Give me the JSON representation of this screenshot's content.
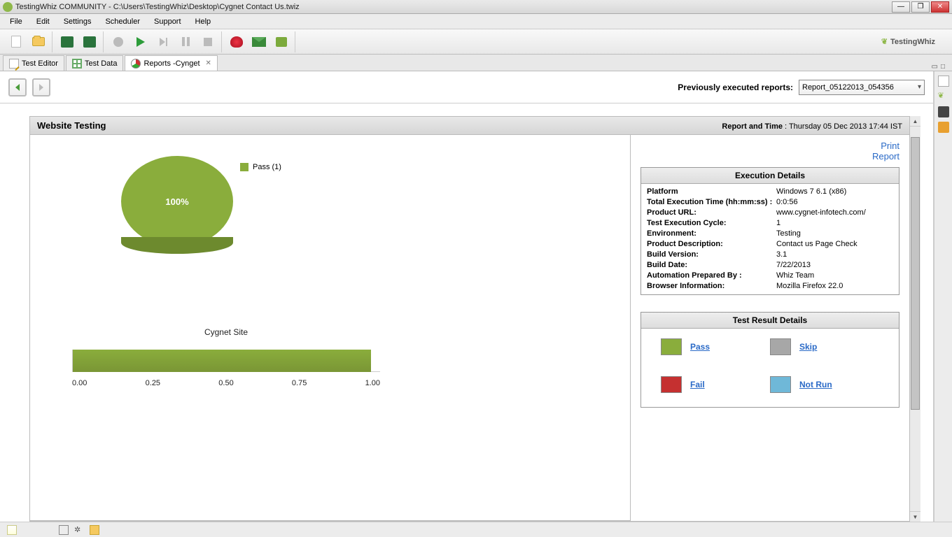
{
  "window": {
    "title": "TestingWhiz COMMUNITY - C:\\Users\\TestingWhiz\\Desktop\\Cygnet Contact Us.twiz"
  },
  "menu": [
    "File",
    "Edit",
    "Settings",
    "Scheduler",
    "Support",
    "Help"
  ],
  "brand": "TestingWhiz",
  "tabs": [
    {
      "label": "Test Editor"
    },
    {
      "label": "Test Data"
    },
    {
      "label": "Reports  -Cynget",
      "active": true
    }
  ],
  "nav": {
    "label": "Previously executed reports:",
    "combo_value": "Report_05122013_054356"
  },
  "report": {
    "title": "Website Testing",
    "time_label": "Report and Time",
    "time_value": " : Thursday 05 Dec 2013 17:44 IST",
    "links": {
      "print": "Print",
      "report": "Report"
    },
    "exec_header": "Execution Details",
    "exec": [
      {
        "k": "Platform",
        "v": "Windows 7 6.1 (x86)"
      },
      {
        "k": "Total Execution Time (hh:mm:ss) :",
        "v": "0:0:56"
      },
      {
        "k": "Product URL:",
        "v": "www.cygnet-infotech.com/"
      },
      {
        "k": "Test Execution Cycle:",
        "v": "1"
      },
      {
        "k": "Environment:",
        "v": "Testing"
      },
      {
        "k": "Product Description:",
        "v": "Contact us Page Check"
      },
      {
        "k": "Build Version:",
        "v": "3.1"
      },
      {
        "k": "Build Date:",
        "v": "7/22/2013"
      },
      {
        "k": "Automation Prepared By :",
        "v": "Whiz Team"
      },
      {
        "k": "Browser Information:",
        "v": "Mozilla Firefox 22.0"
      }
    ],
    "result_header": "Test Result Details",
    "results": {
      "pass": {
        "label": "Pass",
        "color": "#8aad3c"
      },
      "skip": {
        "label": "Skip",
        "color": "#a7a7a7"
      },
      "fail": {
        "label": "Fail",
        "color": "#c53030"
      },
      "notrun": {
        "label": "Not Run",
        "color": "#6fb8d8"
      }
    }
  },
  "chart_data": [
    {
      "type": "pie",
      "title": "",
      "series": [
        {
          "name": "Pass",
          "count": 1,
          "percent": 100,
          "color": "#8aad3c"
        }
      ],
      "legend_text": "Pass (1)",
      "center_text": "100%"
    },
    {
      "type": "bar",
      "title": "Cygnet Site",
      "categories": [
        "Cygnet Site"
      ],
      "values": [
        1.0
      ],
      "xlabel": "",
      "ylabel": "",
      "xlim": [
        0.0,
        1.0
      ],
      "ticks": [
        "0.00",
        "0.25",
        "0.50",
        "0.75",
        "1.00"
      ],
      "bar_color": "#8aad3c",
      "orientation": "horizontal"
    }
  ]
}
